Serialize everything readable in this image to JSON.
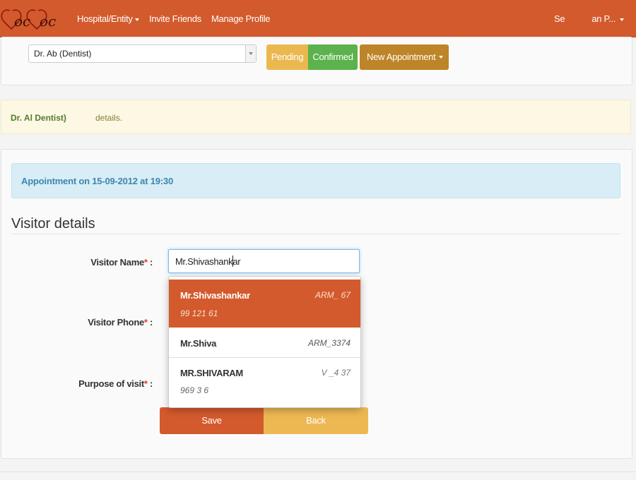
{
  "navbar": {
    "brand": "DocDoc",
    "items": [
      {
        "label": "Hospital/Entity",
        "dropdown": true
      },
      {
        "label": "Invite Friends",
        "dropdown": false
      },
      {
        "label": "Manage Profile",
        "dropdown": false
      }
    ],
    "user_menu": {
      "part1": "Se",
      "part2": "an P..."
    }
  },
  "toolbar": {
    "doctor_select_value": "Dr. Ab      (Dentist)",
    "pending_label": "Pending",
    "confirmed_label": "Confirmed",
    "new_appointment_label": "New Appointment"
  },
  "doctor_alert": {
    "doctor": "Dr. Al        Dentist)",
    "suffix": "details."
  },
  "appointment": {
    "label": "Appointment on 15-09-2012 at 19:30"
  },
  "form": {
    "title": "Visitor details",
    "name_label": "Visitor Name",
    "phone_label": "Visitor Phone",
    "purpose_label": "Purpose of visit",
    "required_mark": "*",
    "colon": ":",
    "name_value": "Mr.Shivashankar"
  },
  "suggestions": [
    {
      "name": "Mr.Shivashankar",
      "id": "ARM_  67",
      "phone": "99  121   61",
      "selected": true
    },
    {
      "name": "Mr.Shiva",
      "id": "ARM_3374",
      "phone": "",
      "selected": false
    },
    {
      "name": "MR.SHIVARAM",
      "id": "V   _4  37",
      "phone": "969    3  6",
      "selected": false
    }
  ],
  "actions": {
    "save_label": "Save",
    "back_label": "Back"
  },
  "colors": {
    "brand": "#d35a2c",
    "pending": "#eab84f",
    "confirmed": "#5cb24c",
    "new_appointment": "#bd8528",
    "back": "#edb853"
  }
}
